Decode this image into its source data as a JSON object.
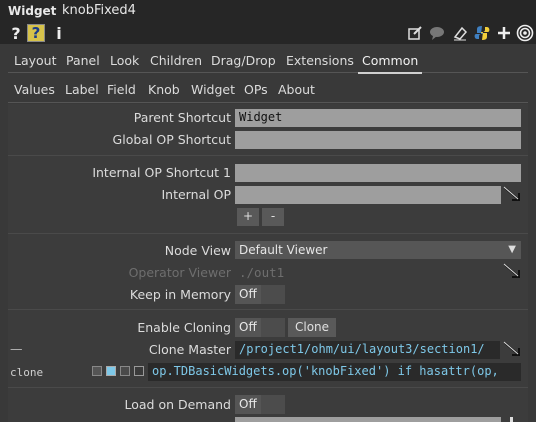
{
  "title": {
    "op_type": "Widget",
    "op_name": "knobFixed4"
  },
  "toolbar": {
    "help_label": "?",
    "info_label": "i"
  },
  "tabs_row1": [
    "Layout",
    "Panel",
    "Look",
    "Children",
    "Drag/Drop",
    "Extensions",
    "Common"
  ],
  "tabs_row2": [
    "Values",
    "Label",
    "Field",
    "Knob",
    "Widget",
    "OPs",
    "About"
  ],
  "active_tab": "Common",
  "params": {
    "parent_shortcut": {
      "label": "Parent Shortcut",
      "value": "Widget"
    },
    "global_op_shortcut": {
      "label": "Global OP Shortcut",
      "value": ""
    },
    "internal_op_shortcut_1": {
      "label": "Internal OP Shortcut 1",
      "value": ""
    },
    "internal_op": {
      "label": "Internal OP",
      "value": ""
    },
    "add_label": "+",
    "remove_label": "-",
    "node_view": {
      "label": "Node View",
      "value": "Default Viewer"
    },
    "operator_viewer": {
      "label": "Operator Viewer",
      "value": "./out1"
    },
    "keep_in_memory": {
      "label": "Keep in Memory",
      "value": "Off"
    },
    "enable_cloning": {
      "label": "Enable Cloning",
      "value": "Off",
      "button": "Clone"
    },
    "clone_master": {
      "label": "Clone Master",
      "value": "/project1/ohm/ui/layout3/section1/",
      "row_mark": "—"
    },
    "clone": {
      "label": "clone",
      "value": "op.TDBasicWidgets.op('knobFixed') if hasattr(op,"
    },
    "load_on_demand": {
      "label": "Load on Demand",
      "value": "Off"
    }
  },
  "colors": {
    "accent": "#7ec8e8",
    "field": "#9e9e9e",
    "background": "#393939"
  }
}
